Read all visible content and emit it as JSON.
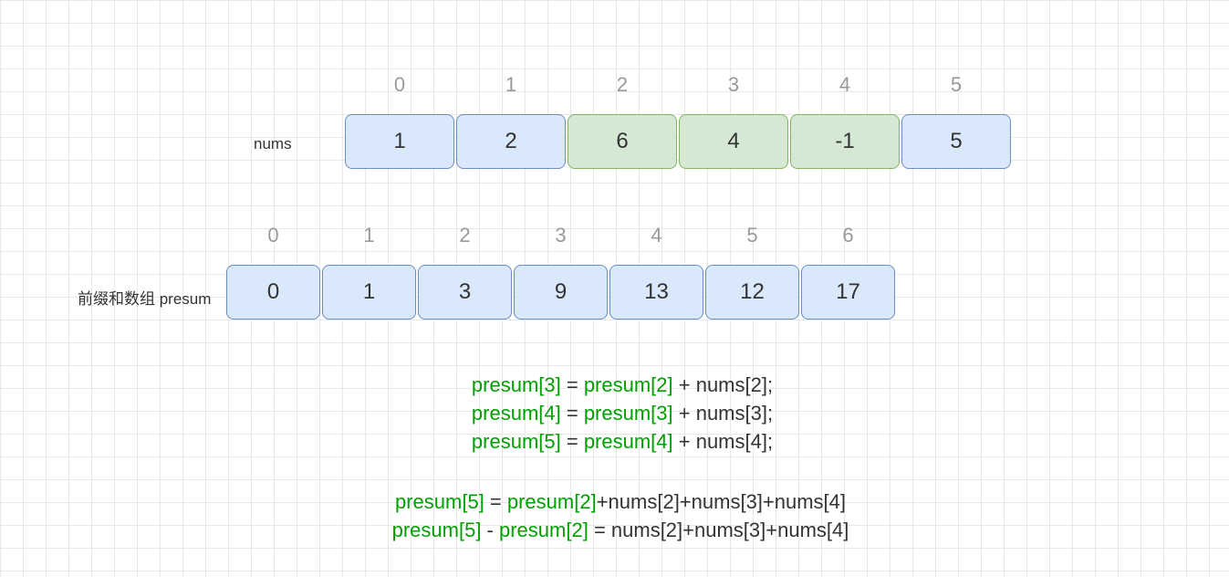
{
  "labels": {
    "nums": "nums",
    "presum": "前缀和数组 presum"
  },
  "nums": {
    "indices": [
      "0",
      "1",
      "2",
      "3",
      "4",
      "5"
    ],
    "values": [
      "1",
      "2",
      "6",
      "4",
      "-1",
      "5"
    ],
    "highlight": [
      false,
      false,
      true,
      true,
      true,
      false
    ]
  },
  "presum": {
    "indices": [
      "0",
      "1",
      "2",
      "3",
      "4",
      "5",
      "6"
    ],
    "values": [
      "0",
      "1",
      "3",
      "9",
      "13",
      "12",
      "17"
    ]
  },
  "formulas1": [
    {
      "g1": "presum[3]",
      "eq": " = ",
      "g2": "presum[2]",
      "rest": " + nums[2];"
    },
    {
      "g1": "presum[4]",
      "eq": " = ",
      "g2": "presum[3]",
      "rest": " + nums[3];"
    },
    {
      "g1": "presum[5]",
      "eq": " = ",
      "g2": "presum[4]",
      "rest": " + nums[4];"
    }
  ],
  "formulas2": [
    {
      "g1": "presum[5]",
      "mid1": " = ",
      "g2": "presum[2]",
      "rest": "+nums[2]+nums[3]+nums[4]"
    },
    {
      "g1": "presum[5]",
      "mid1": " - ",
      "g2": "presum[2]",
      "rest": " = nums[2]+nums[3]+nums[4]"
    }
  ]
}
